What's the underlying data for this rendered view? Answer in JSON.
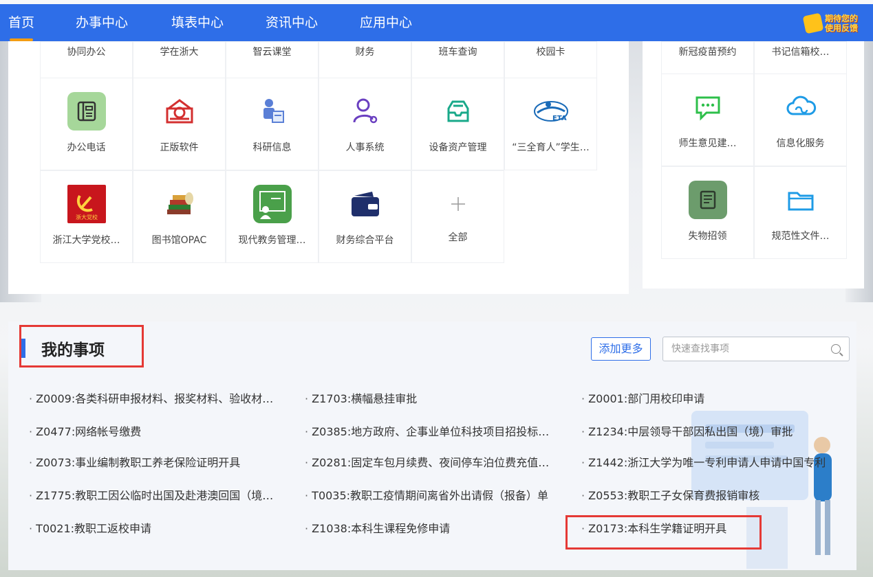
{
  "nav": {
    "items": [
      "首页",
      "办事中心",
      "填表中心",
      "资讯中心",
      "应用中心"
    ],
    "feedback": [
      "期待您的",
      "使用反馈"
    ]
  },
  "apps_top": [
    "协同办公",
    "学在浙大",
    "智云课堂",
    "财务",
    "班车查询",
    "校园卡"
  ],
  "apps_row2": [
    "办公电话",
    "正版软件",
    "科研信息",
    "人事系统",
    "设备资产管理",
    "“三全育人”学生…"
  ],
  "apps_row3": [
    "浙江大学党校…",
    "图书馆OPAC",
    "现代教务管理…",
    "财务综合平台",
    "全部"
  ],
  "right_apps": {
    "top": [
      "新冠疫苗预约",
      "书记信箱校…"
    ],
    "row2": [
      "师生意见建…",
      "信息化服务"
    ],
    "row3": [
      "失物招领",
      "规范性文件…"
    ]
  },
  "icon_text": {
    "eta": "ETA",
    "party": "浙大党校"
  },
  "my_items": {
    "title": "我的事项",
    "add_more": "添加更多",
    "search_placeholder": "快速查找事项",
    "list": [
      [
        "Z0009:各类科研申报材料、报奖材料、验收材…",
        "Z1703:横幅悬挂审批",
        "Z0001:部门用校印申请"
      ],
      [
        "Z0477:网络帐号缴费",
        "Z0385:地方政府、企事业单位科技项目招投标…",
        "Z1234:中层领导干部因私出国（境）审批"
      ],
      [
        "Z0073:事业编制教职工养老保险证明开具",
        "Z0281:固定车包月续费、夜间停车泊位费充值…",
        "Z1442:浙江大学为唯一专利申请人申请中国专利"
      ],
      [
        "Z1775:教职工因公临时出国及赴港澳回国（境…",
        "T0035:教职工疫情期间离省外出请假（报备）单",
        "Z0553:教职工子女保育费报销审核"
      ],
      [
        "T0021:教职工返校申请",
        "Z1038:本科生课程免修申请",
        "Z0173:本科生学籍证明开具"
      ]
    ]
  }
}
